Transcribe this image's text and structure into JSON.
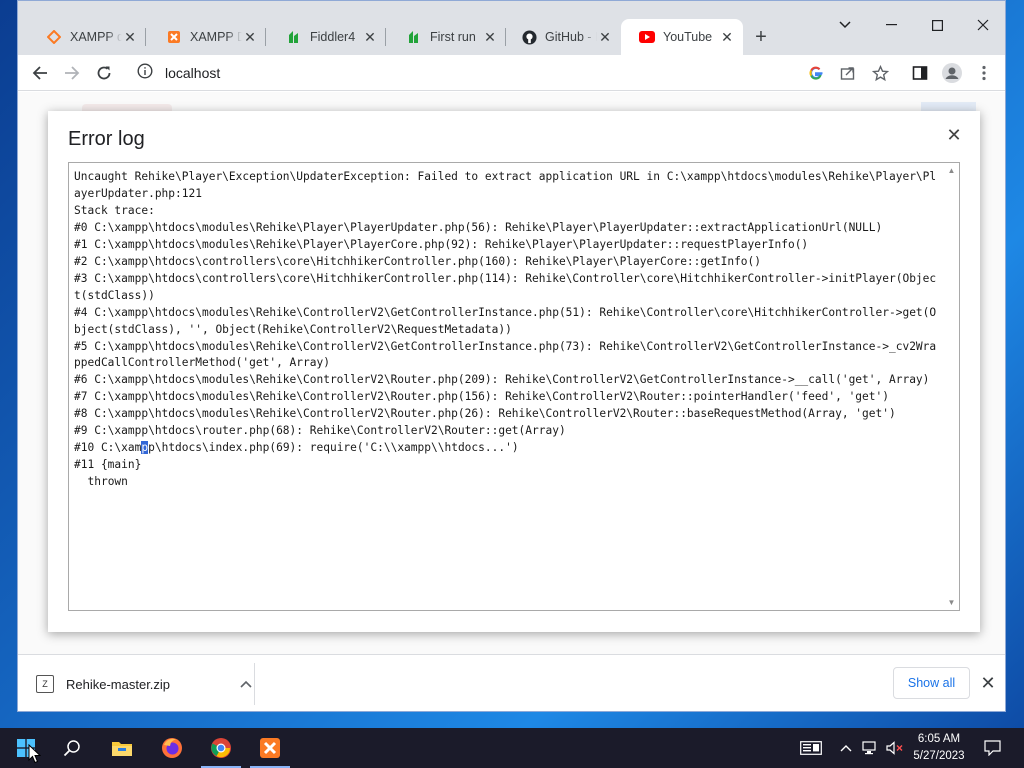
{
  "browser": {
    "tabs": [
      {
        "title": "XAMPP dashboard",
        "icon": "xampp-icon",
        "active": false
      },
      {
        "title": "XAMPP Dashboard",
        "icon": "xampp-icon",
        "active": false
      },
      {
        "title": "Fiddler4",
        "icon": "fiddler-icon",
        "active": false
      },
      {
        "title": "First run",
        "icon": "fiddler-icon",
        "active": false
      },
      {
        "title": "GitHub - Rehike",
        "icon": "github-icon",
        "active": false
      },
      {
        "title": "YouTube",
        "icon": "youtube-icon",
        "active": true
      }
    ],
    "address": "localhost",
    "accent": "#1a73e8"
  },
  "modal": {
    "title": "Error log",
    "log_lines": [
      "Uncaught Rehike\\Player\\Exception\\UpdaterException: Failed to extract application URL in C:\\xampp\\htdocs\\modules\\Rehike\\Player\\PlayerUpdater.php:121",
      "Stack trace:",
      "#0 C:\\xampp\\htdocs\\modules\\Rehike\\Player\\PlayerUpdater.php(56): Rehike\\Player\\PlayerUpdater::extractApplicationUrl(NULL)",
      "#1 C:\\xampp\\htdocs\\modules\\Rehike\\Player\\PlayerCore.php(92): Rehike\\Player\\PlayerUpdater::requestPlayerInfo()",
      "#2 C:\\xampp\\htdocs\\controllers\\core\\HitchhikerController.php(160): Rehike\\Player\\PlayerCore::getInfo()",
      "#3 C:\\xampp\\htdocs\\controllers\\core\\HitchhikerController.php(114): Rehike\\Controller\\core\\HitchhikerController->initPlayer(Object(stdClass))",
      "#4 C:\\xampp\\htdocs\\modules\\Rehike\\ControllerV2\\GetControllerInstance.php(51): Rehike\\Controller\\core\\HitchhikerController->get(Object(stdClass), '', Object(Rehike\\ControllerV2\\RequestMetadata))",
      "#5 C:\\xampp\\htdocs\\modules\\Rehike\\ControllerV2\\GetControllerInstance.php(73): Rehike\\ControllerV2\\GetControllerInstance->_cv2WrappedCallControllerMethod('get', Array)",
      "#6 C:\\xampp\\htdocs\\modules\\Rehike\\ControllerV2\\Router.php(209): Rehike\\ControllerV2\\GetControllerInstance->__call('get', Array)",
      "#7 C:\\xampp\\htdocs\\modules\\Rehike\\ControllerV2\\Router.php(156): Rehike\\ControllerV2\\Router::pointerHandler('feed', 'get')",
      "#8 C:\\xampp\\htdocs\\modules\\Rehike\\ControllerV2\\Router.php(26): Rehike\\ControllerV2\\Router::baseRequestMethod(Array, 'get')",
      "#9 C:\\xampp\\htdocs\\router.php(68): Rehike\\ControllerV2\\Router::get(Array)",
      "#11 {main}",
      "  thrown"
    ],
    "line10_before": "#10 C:\\xam",
    "line10_selected": "p",
    "line10_after": "p\\htdocs\\index.php(69): require('C:\\\\xampp\\\\htdocs...')"
  },
  "downloads": {
    "file_name": "Rehike-master.zip",
    "show_all_label": "Show all"
  },
  "taskbar": {
    "time": "6:05 AM",
    "date": "5/27/2023",
    "apps": [
      "windows-start-icon",
      "search-icon",
      "file-explorer-icon",
      "firefox-icon",
      "chrome-icon",
      "xampp-icon"
    ]
  }
}
